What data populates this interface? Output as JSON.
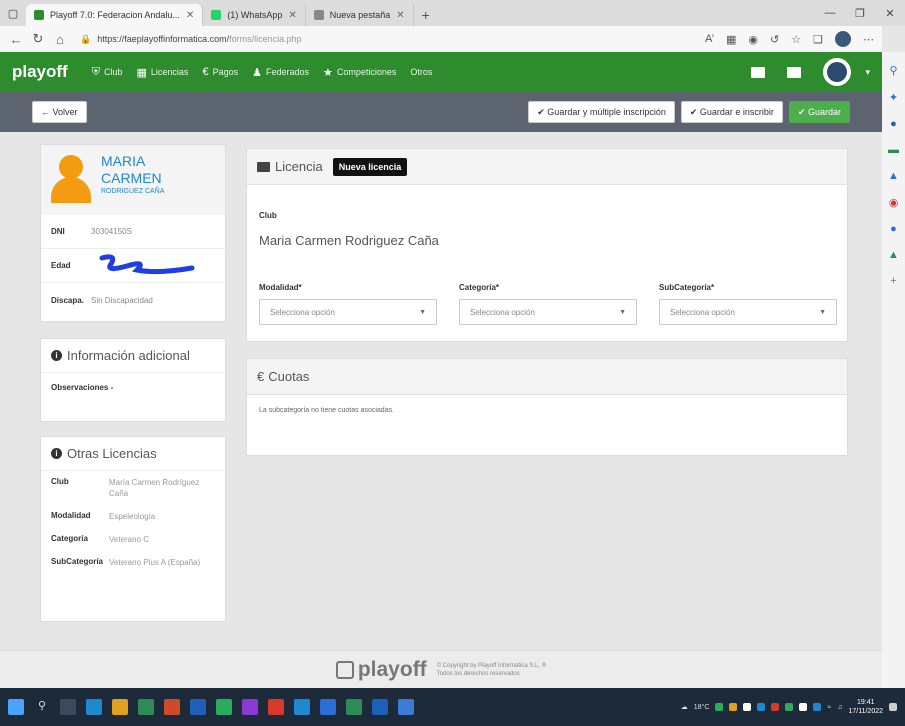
{
  "browser": {
    "tabs": [
      {
        "label": "Playoff 7.0: Federacion Andalu...",
        "color": "#2e8b2e",
        "active": true
      },
      {
        "label": "(1) WhatsApp",
        "color": "#25d366",
        "active": false
      },
      {
        "label": "Nueva pestaña",
        "color": "#888888",
        "active": false
      }
    ],
    "url_host": "https://faeplayoffinformatica.com/",
    "url_path": "forms/licencia.php"
  },
  "nav": {
    "logo": "playoff",
    "items": [
      "Club",
      "Licencias",
      "Pagos",
      "Federados",
      "Competiciones",
      "Otros"
    ]
  },
  "toolbar": {
    "back_label": "← Volver",
    "save_multi_label": "✔ Guardar y múltiple inscripción",
    "save_inscribe_label": "✔ Guardar e inscribir",
    "save_label": "✔ Guardar"
  },
  "profile": {
    "first_name": "MARIA",
    "middle_name": "CARMEN",
    "surname": "RODRIGUEZ CAÑA",
    "dni_label": "DNI",
    "dni_value": "30304150S",
    "edad_label": "Edad",
    "discap_label": "Discapa.",
    "discap_value": "Sin Discapacidad"
  },
  "info": {
    "title": "Información adicional",
    "obs_label": "Observaciones -"
  },
  "other": {
    "title": "Otras Licencias",
    "rows": [
      {
        "label": "Club",
        "value": "María Carmen Rodríguez Caña"
      },
      {
        "label": "Modalidad",
        "value": "Espeleología"
      },
      {
        "label": "Categoría",
        "value": "Veterano C"
      },
      {
        "label": "SubCategoría",
        "value": "Veterano Plus A (España)"
      }
    ]
  },
  "licencia": {
    "title": "Licencia",
    "badge": "Nueva licencia",
    "club_label": "Club",
    "club_value": "Maria Carmen Rodriguez Caña",
    "modalidad_label": "Modalidad*",
    "categoria_label": "Categoría*",
    "subcategoria_label": "SubCategoría*",
    "select_placeholder": "Selecciona opción"
  },
  "cuotas": {
    "title": "Cuotas",
    "message": "La subcategoría no tiene cuotas asociadas."
  },
  "footer": {
    "logo": "playoff",
    "copy1": "© Copyright by Playoff Informática S.L. ®",
    "copy2": "Todos los derechos reservados"
  },
  "taskbar": {
    "weather": "18°C",
    "time": "19:41",
    "date": "17/11/2022"
  }
}
